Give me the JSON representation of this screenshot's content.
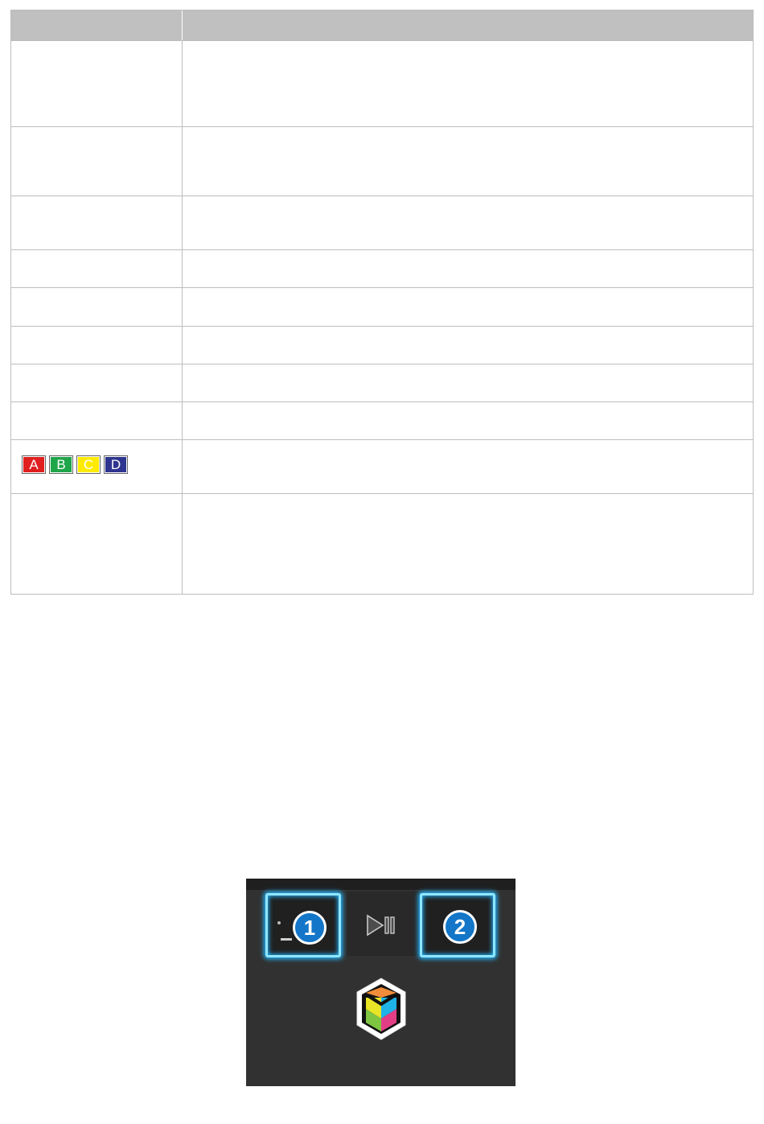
{
  "table": {
    "header": [
      "",
      ""
    ],
    "rows": [
      {
        "key": "",
        "value": ""
      },
      {
        "key": "",
        "value": ""
      },
      {
        "key": "",
        "value": ""
      },
      {
        "key": "",
        "value": ""
      },
      {
        "key": "",
        "value": ""
      },
      {
        "key": "",
        "value": ""
      },
      {
        "key": "",
        "value": ""
      },
      {
        "key": "",
        "value": ""
      },
      {
        "key": "",
        "value": "",
        "color_buttons": [
          {
            "label": "A",
            "color": "#e0201f",
            "text_color": "#ffffff"
          },
          {
            "label": "B",
            "color": "#1fa54a",
            "text_color": "#ffffff"
          },
          {
            "label": "C",
            "color": "#ffeb00",
            "text_color": "#ffffff"
          },
          {
            "label": "D",
            "color": "#2e3590",
            "text_color": "#ffffff"
          }
        ]
      },
      {
        "key": "",
        "value": ""
      }
    ]
  },
  "remote_photo": {
    "callouts": [
      {
        "number": "1"
      },
      {
        "number": "2"
      }
    ],
    "icons": [
      "play-pause-icon",
      "smart-hub-icon"
    ],
    "glow_color": "#22b6ff",
    "badge_color": "#1376c8"
  }
}
